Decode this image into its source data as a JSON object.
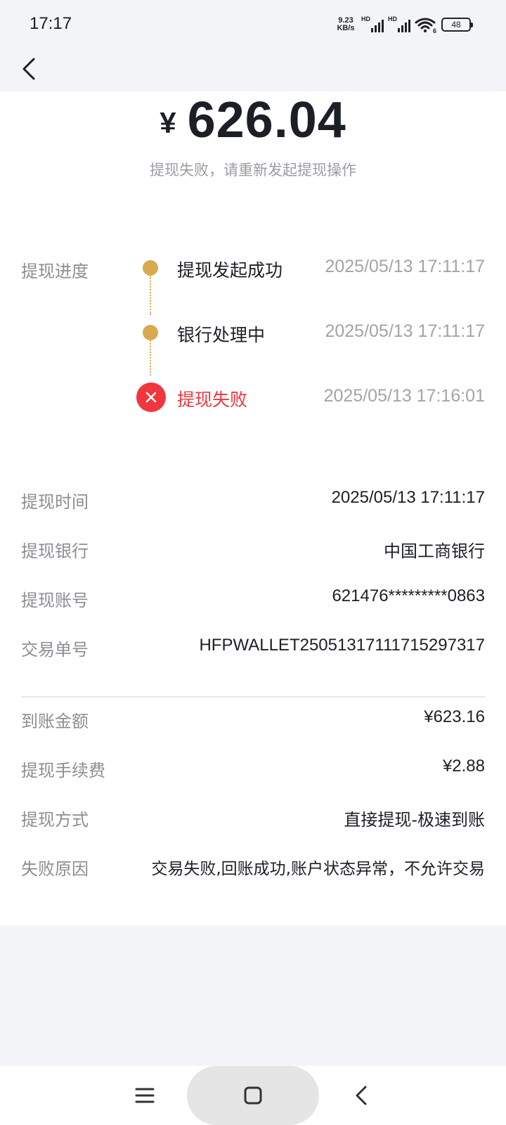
{
  "status_bar": {
    "time": "17:17",
    "net_speed_value": "9.23",
    "net_speed_unit": "KB/s",
    "sim1_label": "HD",
    "sim2_label": "HD",
    "wifi_label": "6",
    "battery": "48"
  },
  "header": {
    "back_icon": "chevron-left-icon"
  },
  "amount": {
    "currency": "¥",
    "value": "626.04",
    "subtitle": "提现失败，请重新发起提现操作"
  },
  "progress": {
    "label": "提现进度",
    "steps": [
      {
        "title": "提现发起成功",
        "time": "2025/05/13 17:11:17",
        "status": "done"
      },
      {
        "title": "银行处理中",
        "time": "2025/05/13 17:11:17",
        "status": "done"
      },
      {
        "title": "提现失败",
        "time": "2025/05/13 17:16:01",
        "status": "failed"
      }
    ]
  },
  "details": [
    {
      "label": "提现时间",
      "value": "2025/05/13 17:11:17"
    },
    {
      "label": "提现银行",
      "value": "中国工商银行"
    },
    {
      "label": "提现账号",
      "value": "621476*********0863"
    },
    {
      "label": "交易单号",
      "value": "HFPWALLET2505131711171529731​7"
    }
  ],
  "details2": [
    {
      "label": "到账金额",
      "value": "¥623.16"
    },
    {
      "label": "提现手续费",
      "value": "¥2.88"
    },
    {
      "label": "提现方式",
      "value": "直接提现-极速到账"
    },
    {
      "label": "失败原因",
      "value": "交易失败,回账成功,账户状态异常，不允许交易"
    }
  ],
  "colors": {
    "accent_gold": "#d9a94f",
    "error_red": "#f0373d"
  },
  "nav_bar": {
    "menu_icon": "menu-icon",
    "home_icon": "home-icon",
    "back_icon": "back-icon"
  }
}
